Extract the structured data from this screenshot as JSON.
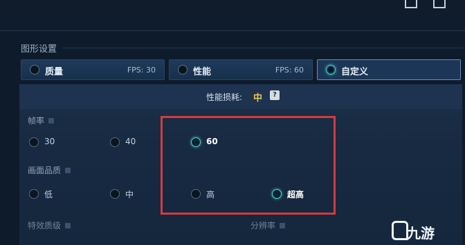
{
  "section": {
    "title": "图形设置"
  },
  "presets": [
    {
      "label": "质量",
      "fps": "FPS: 30",
      "selected": false
    },
    {
      "label": "性能",
      "fps": "FPS: 60",
      "selected": false
    },
    {
      "label": "自定义",
      "fps": "",
      "selected": true
    }
  ],
  "performance": {
    "label": "性能损耗:",
    "value": "中",
    "help_icon": "?"
  },
  "frame_rate": {
    "title": "帧率",
    "options": [
      {
        "label": "30",
        "selected": false
      },
      {
        "label": "40",
        "selected": false
      },
      {
        "label": "60",
        "selected": true
      }
    ]
  },
  "quality": {
    "title": "画面品质",
    "options": [
      {
        "label": "低",
        "selected": false
      },
      {
        "label": "中",
        "selected": false
      },
      {
        "label": "高",
        "selected": false
      },
      {
        "label": "超高",
        "selected": true
      }
    ]
  },
  "bottom_groups": {
    "effects_title": "特效质级",
    "resolution_title": "分辨率"
  },
  "watermark": {
    "text": "九游"
  },
  "colors": {
    "accent_teal": "#4fd2c7",
    "highlight_red": "#d63a3f",
    "cost_yellow": "#f2c84b"
  }
}
